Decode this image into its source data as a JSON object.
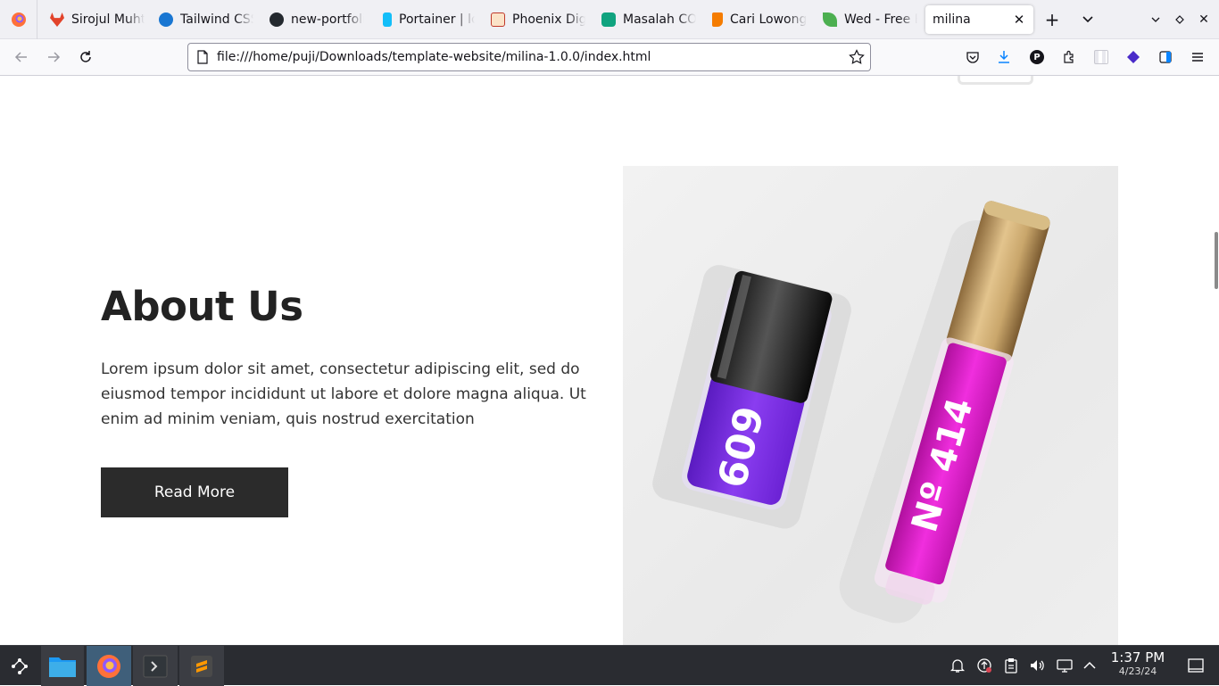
{
  "browser": {
    "tabs": [
      {
        "title": "Sirojul Muhtar",
        "color": "#e2432a"
      },
      {
        "title": "Tailwind CSS",
        "color": "#1976d2"
      },
      {
        "title": "new-portfolio",
        "color": "#24292f"
      },
      {
        "title": "Portainer | lo",
        "color": "#13bef9"
      },
      {
        "title": "Phoenix Digit",
        "color": "#c0392b"
      },
      {
        "title": "Masalah COR",
        "color": "#10a37f"
      },
      {
        "title": "Cari Lowonga",
        "color": "#f57c00"
      },
      {
        "title": "Wed - Free B",
        "color": "#4caf50"
      },
      {
        "title": "milina",
        "active": true
      }
    ],
    "url": "file:///home/puji/Downloads/template-website/milina-1.0.0/index.html"
  },
  "page": {
    "about": {
      "title": "About Us",
      "text": "Lorem ipsum dolor sit amet, consectetur adipiscing elit, sed do eiusmod tempor incididunt ut labore et dolore magna aliqua. Ut enim ad minim veniam, quis nostrud exercitation",
      "button_label": "Read More"
    },
    "image": {
      "nail_polish_label": "609",
      "lip_gloss_label": "Nº 414",
      "colors": {
        "polish": "#7a2ee0",
        "gloss": "#e21ed0",
        "cap_gold": "#c9a66b"
      }
    }
  },
  "taskbar": {
    "time": "1:37 PM",
    "date": "4/23/24"
  }
}
